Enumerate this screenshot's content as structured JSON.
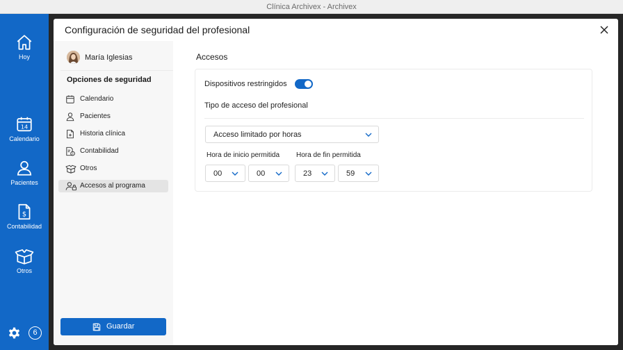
{
  "window": {
    "title": "Clínica Archivex - Archivex"
  },
  "nav": {
    "items": [
      {
        "label": "Hoy",
        "icon": "home-icon"
      },
      {
        "label": "Calendario",
        "icon": "calendar-icon",
        "day": "14"
      },
      {
        "label": "Pacientes",
        "icon": "user-icon"
      },
      {
        "label": "Contabilidad",
        "icon": "invoice-icon"
      },
      {
        "label": "Otros",
        "icon": "box-icon"
      }
    ],
    "badge": "6"
  },
  "modal": {
    "title": "Configuración de seguridad del profesional",
    "user_name": "María Iglesias",
    "section_title": "Opciones de seguridad",
    "menu": [
      {
        "label": "Calendario",
        "icon": "calendar-icon"
      },
      {
        "label": "Pacientes",
        "icon": "user-icon"
      },
      {
        "label": "Historia clínica",
        "icon": "medical-file-icon"
      },
      {
        "label": "Contabilidad",
        "icon": "accounting-icon"
      },
      {
        "label": "Otros",
        "icon": "box-icon"
      },
      {
        "label": "Accesos al programa",
        "icon": "user-lock-icon",
        "active": true
      }
    ],
    "save_label": "Guardar"
  },
  "access": {
    "title": "Accesos",
    "restricted_devices_label": "Dispositivos restringidos",
    "restricted_devices_on": true,
    "access_type_label": "Tipo de acceso del profesional",
    "access_type_value": "Acceso limitado por horas",
    "start_label": "Hora de inicio permitida",
    "end_label": "Hora de fin permitida",
    "start_hour": "00",
    "start_minute": "00",
    "end_hour": "23",
    "end_minute": "59"
  },
  "colors": {
    "accent": "#1268c7",
    "active_item": "#e4e4e4"
  }
}
